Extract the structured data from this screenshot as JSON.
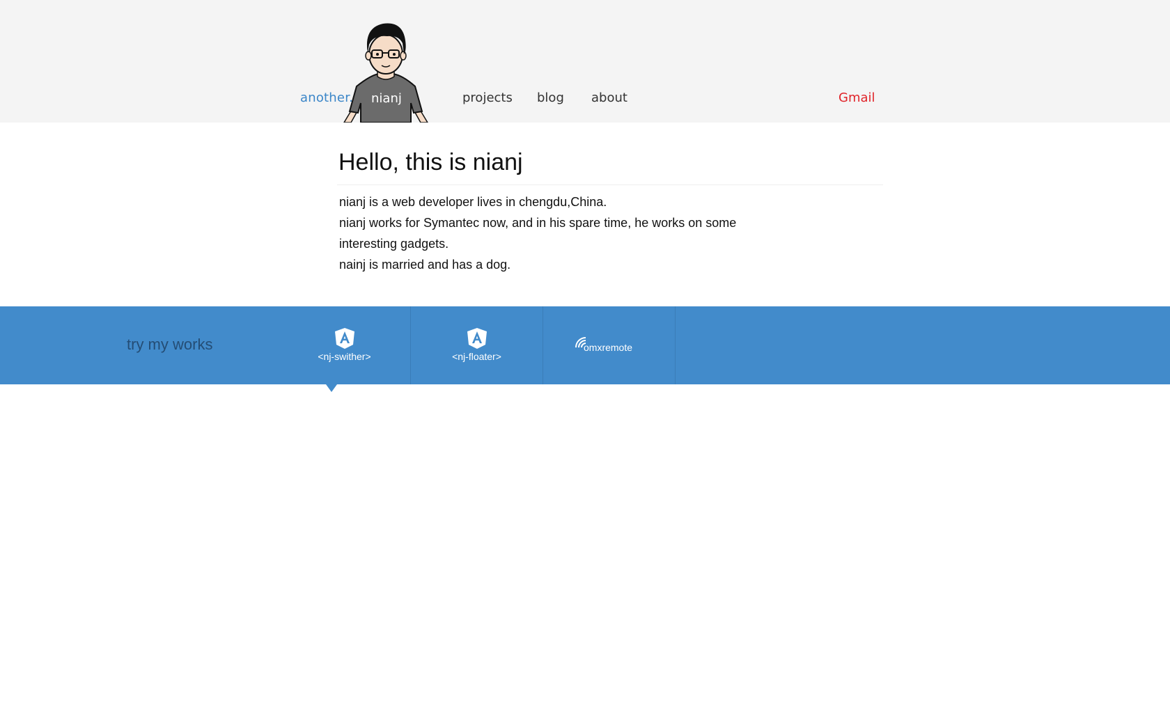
{
  "header": {
    "logo_prefix": "another.",
    "logo_name": "nianj",
    "nav": [
      "projects",
      "blog",
      "about"
    ],
    "contact_label": "Gmail",
    "colors": {
      "background": "#f4f4f4",
      "logo_prefix": "#3b86c8",
      "contact": "#e0242a",
      "nav_text": "#333333"
    }
  },
  "intro": {
    "title": "Hello, this is nianj",
    "lines": [
      "nianj is a web developer lives in chengdu,China.",
      "nianj works for Symantec now, and in his spare time, he works on some interesting gadgets.",
      "nainj is married and has a dog."
    ]
  },
  "works": {
    "label": "try my works",
    "bar_color": "#428bcb",
    "items": [
      {
        "icon": "angular-shield-icon",
        "label": "<nj-swither>",
        "selected": true
      },
      {
        "icon": "angular-shield-icon",
        "label": "<nj-floater>",
        "selected": false
      },
      {
        "icon": "wifi-signal-icon",
        "label": "omxremote",
        "selected": false
      }
    ]
  }
}
